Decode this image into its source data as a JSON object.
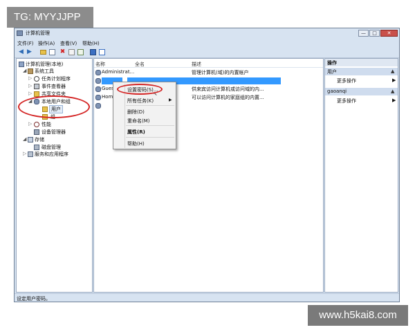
{
  "watermarks": {
    "top_left": "TG: MYYJJPP",
    "bottom_right": "www.h5kai8.com"
  },
  "window": {
    "title": "计算机管理",
    "controls": {
      "minimize": "—",
      "maximize": "□",
      "close": "✕"
    }
  },
  "menu": [
    "文件(F)",
    "操作(A)",
    "查看(V)",
    "帮助(H)"
  ],
  "tree": {
    "root": "计算机管理(本地)",
    "system_tools": "系统工具",
    "task_scheduler": "任务计划程序",
    "event_viewer": "事件查看器",
    "shared_folders": "共享文件夹",
    "local_users_groups": "本地用户和组",
    "users": "用户",
    "groups": "组",
    "performance": "性能",
    "device_manager": "设备管理器",
    "storage": "存储",
    "disk_management": "磁盘管理",
    "services_apps": "服务和应用程序"
  },
  "list": {
    "columns": {
      "name": "名称",
      "fullname": "全名",
      "description": "描述"
    },
    "rows": [
      {
        "name": "Administrat...",
        "description": "管理计算机(域)的内置帐户"
      },
      {
        "name": "",
        "description": ""
      },
      {
        "name": "Guest",
        "description": "供来宾访问计算机或访问域的内..."
      },
      {
        "name": "Home...",
        "description": "可以访问计算机的家庭组的内置..."
      }
    ]
  },
  "context_menu": {
    "set_password": "设置密码(S)...",
    "all_tasks": "所有任务(K)",
    "delete": "删除(D)",
    "rename": "重命名(M)",
    "properties": "属性(R)",
    "help": "帮助(H)"
  },
  "actions": {
    "header": "操作",
    "section1": "用户",
    "more1": "更多操作",
    "section2": "gaoanqi",
    "more2": "更多操作"
  },
  "status": "设定用户密码。",
  "colors": {
    "highlight_row": "#3399ff",
    "annotation_ring": "#d42424",
    "window_frame": "#d7e3f1"
  }
}
